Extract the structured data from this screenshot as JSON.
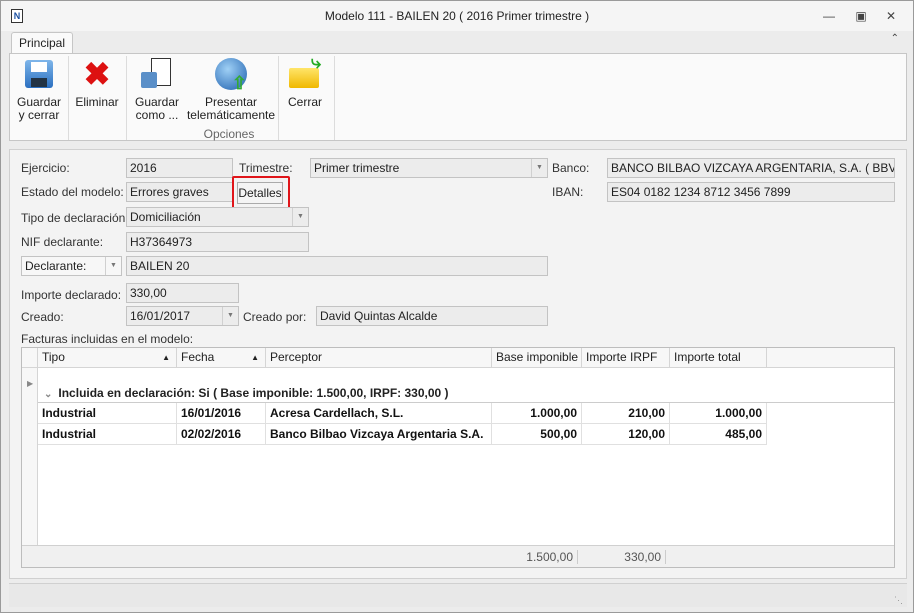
{
  "window": {
    "title": "Modelo 111 - BAILEN  20 ( 2016 Primer trimestre )"
  },
  "ribbon": {
    "tab": "Principal",
    "group_label": "Opciones",
    "buttons": {
      "guardar_cerrar": "Guardar\ny cerrar",
      "eliminar": "Eliminar",
      "guardar_como": "Guardar\ncomo ...",
      "presentar": "Presentar\ntelemáticamente",
      "cerrar": "Cerrar"
    }
  },
  "form": {
    "ejercicio_label": "Ejercicio:",
    "ejercicio": "2016",
    "trimestre_label": "Trimestre:",
    "trimestre": "Primer trimestre",
    "banco_label": "Banco:",
    "banco": "BANCO BILBAO VIZCAYA ARGENTARIA, S.A. ( BBVAESMM)",
    "estado_label": "Estado del modelo:",
    "estado": "Errores graves",
    "detalles": "Detalles",
    "iban_label": "IBAN:",
    "iban": "ES04 0182 1234 8712 3456 7899",
    "tipo_label": "Tipo de declaración:",
    "tipo": "Domiciliación",
    "nif_label": "NIF declarante:",
    "nif": "H37364973",
    "declarante_select": "Declarante:",
    "declarante": "BAILEN  20",
    "importe_label": "Importe declarado:",
    "importe": "330,00",
    "creado_label": "Creado:",
    "creado": "16/01/2017",
    "creado_por_label": "Creado por:",
    "creado_por": "David Quintas Alcalde",
    "facturas_label": "Facturas incluidas en el modelo:"
  },
  "grid": {
    "columns": [
      "Tipo",
      "Fecha",
      "Perceptor",
      "Base imponible",
      "Importe IRPF",
      "Importe total"
    ],
    "group": "Incluida en declaración: Si ( Base imponible: 1.500,00,  IRPF: 330,00 )",
    "rows": [
      [
        "Industrial",
        "16/01/2016",
        "Acresa Cardellach, S.L.",
        "1.000,00",
        "210,00",
        "1.000,00"
      ],
      [
        "Industrial",
        "02/02/2016",
        "Banco Bilbao Vizcaya Argentaria S.A.",
        "500,00",
        "120,00",
        "485,00"
      ]
    ],
    "totals": {
      "base": "1.500,00",
      "irpf": "330,00"
    }
  }
}
